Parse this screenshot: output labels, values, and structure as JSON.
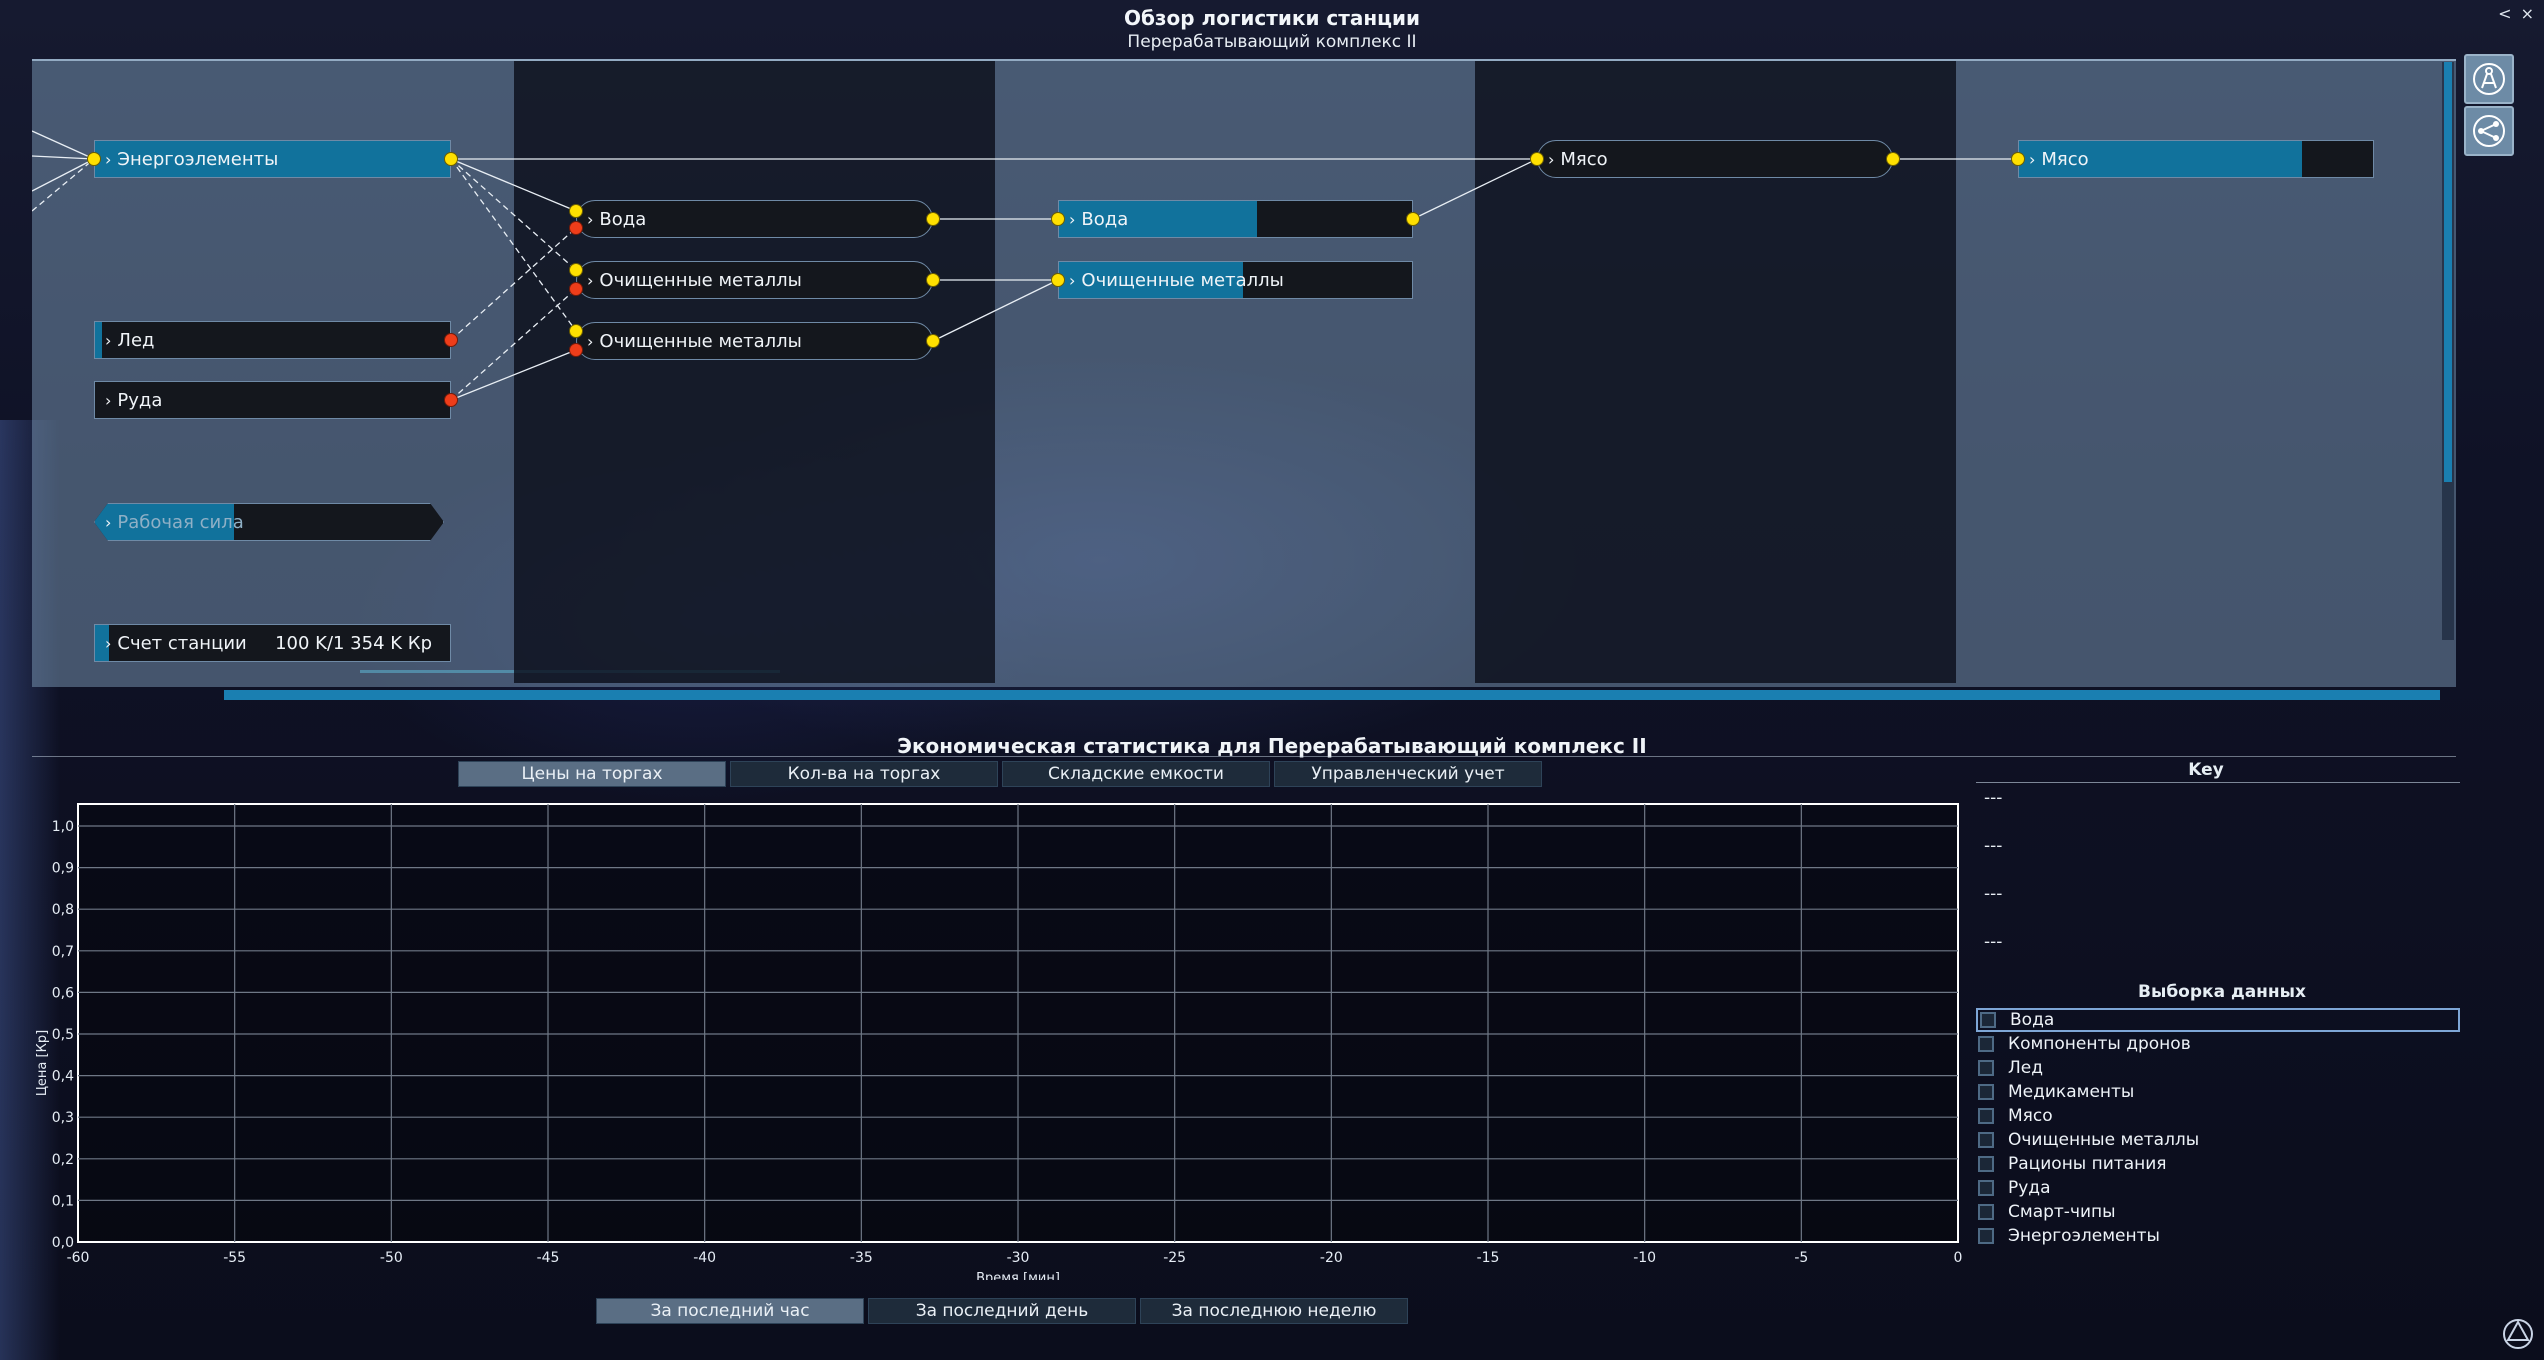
{
  "window": {
    "title": "Обзор логистики станции",
    "subtitle": "Перерабатывающий комплекс II",
    "close_label": "< ×"
  },
  "side_buttons": [
    {
      "icon": "architect-icon"
    },
    {
      "icon": "share-nodes-icon"
    }
  ],
  "nodes": {
    "energy": {
      "label": "Энергоэлементы",
      "fill": 1.0
    },
    "ice": {
      "label": "Лед",
      "fill": 0.02
    },
    "ore": {
      "label": "Руда",
      "fill": 0.0
    },
    "workforce": {
      "label": "Рабочая сила",
      "fill": 0.4
    },
    "account": {
      "label": "Счет станции",
      "value": "100 K/1 354 K Кр",
      "fill": 0.03
    },
    "prod_water": {
      "label": "Вода"
    },
    "prod_metals_1": {
      "label": "Очищенные металлы"
    },
    "prod_metals_2": {
      "label": "Очищенные металлы"
    },
    "store_water": {
      "label": "Вода",
      "fill": 0.56
    },
    "store_metals": {
      "label": "Очищенные металлы",
      "fill": 0.52
    },
    "prod_meat": {
      "label": "Мясо"
    },
    "store_meat": {
      "label": "Мясо",
      "fill": 0.8
    }
  },
  "economy": {
    "title": "Экономическая статистика для Перерабатывающий комплекс II",
    "tabs": [
      {
        "label": "Цены на торгах",
        "active": true
      },
      {
        "label": "Кол-ва на торгах",
        "active": false
      },
      {
        "label": "Складские емкости",
        "active": false
      },
      {
        "label": "Управленческий учет",
        "active": false
      }
    ],
    "range_tabs": [
      {
        "label": "За последний час",
        "active": true
      },
      {
        "label": "За последний день",
        "active": false
      },
      {
        "label": "За последнюю неделю",
        "active": false
      }
    ],
    "key": {
      "title": "Key",
      "items": [
        "---",
        "---",
        "---",
        "---"
      ]
    },
    "selection": {
      "title": "Выборка данных",
      "items": [
        "Вода",
        "Компоненты дронов",
        "Лед",
        "Медикаменты",
        "Мясо",
        "Очищенные металлы",
        "Рационы питания",
        "Руда",
        "Смарт-чипы",
        "Энергоэлементы"
      ]
    }
  },
  "chart_data": {
    "type": "line",
    "title": "",
    "xlabel": "Время [мин]",
    "ylabel": "Цена [Кр]",
    "xlim": [
      -60,
      0
    ],
    "ylim": [
      0,
      1.0
    ],
    "x_ticks": [
      "-60",
      "-55",
      "-50",
      "-45",
      "-40",
      "-35",
      "-30",
      "-25",
      "-20",
      "-15",
      "-10",
      "-5",
      "0"
    ],
    "y_ticks": [
      "0,0",
      "0,1",
      "0,2",
      "0,3",
      "0,4",
      "0,5",
      "0,6",
      "0,7",
      "0,8",
      "0,9",
      "1,0"
    ],
    "grid": true,
    "series": []
  }
}
